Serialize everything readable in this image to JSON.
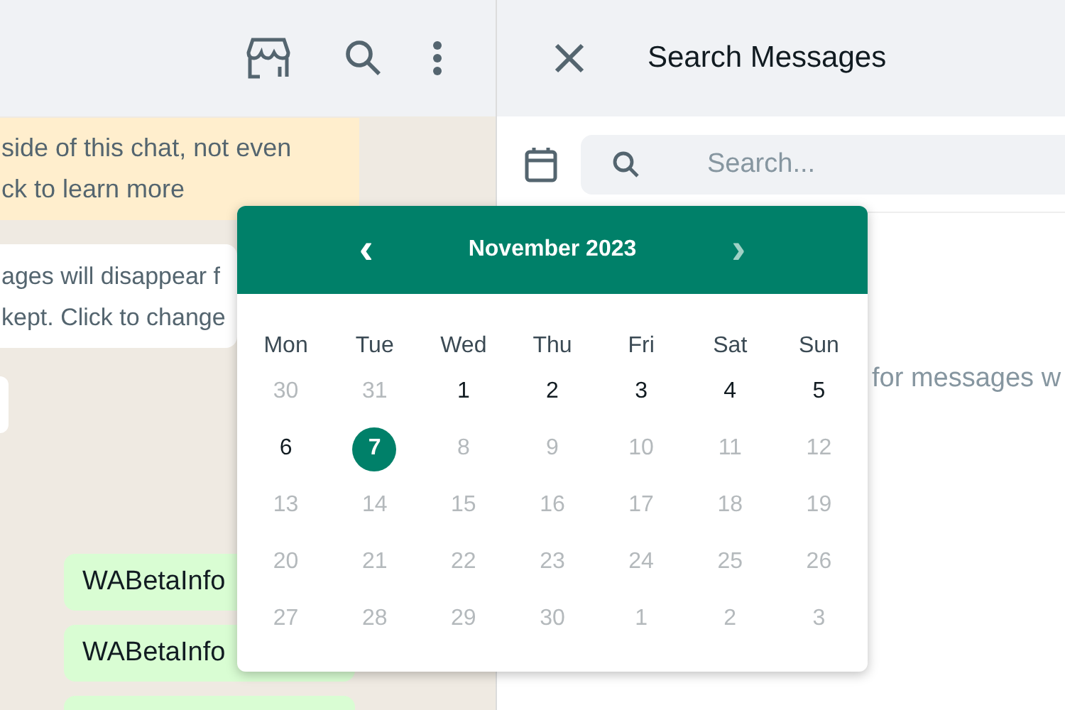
{
  "chat": {
    "banner_lines": [
      "side of this chat, not even",
      "ck to learn more"
    ],
    "system_lines": [
      "ages will disappear f",
      "kept. Click to change"
    ],
    "bubbles": [
      {
        "kind": "text",
        "text": "WABetaInfo"
      },
      {
        "kind": "text",
        "text": "WABetaInfo"
      },
      {
        "kind": "blank"
      }
    ]
  },
  "search_panel": {
    "title": "Search Messages",
    "search": {
      "placeholder": "Search..."
    },
    "hint": "for messages w"
  },
  "calendar": {
    "prev": "‹",
    "month": "November 2023",
    "next": "›",
    "weekdays": [
      "Mon",
      "Tue",
      "Wed",
      "Thu",
      "Fri",
      "Sat",
      "Sun"
    ],
    "days": [
      {
        "label": "30",
        "disabled": true,
        "selected": false
      },
      {
        "label": "31",
        "disabled": true,
        "selected": false
      },
      {
        "label": "1",
        "disabled": false,
        "selected": false
      },
      {
        "label": "2",
        "disabled": false,
        "selected": false
      },
      {
        "label": "3",
        "disabled": false,
        "selected": false
      },
      {
        "label": "4",
        "disabled": false,
        "selected": false
      },
      {
        "label": "5",
        "disabled": false,
        "selected": false
      },
      {
        "label": "6",
        "disabled": false,
        "selected": false
      },
      {
        "label": "7",
        "disabled": false,
        "selected": true
      },
      {
        "label": "8",
        "disabled": true,
        "selected": false
      },
      {
        "label": "9",
        "disabled": true,
        "selected": false
      },
      {
        "label": "10",
        "disabled": true,
        "selected": false
      },
      {
        "label": "11",
        "disabled": true,
        "selected": false
      },
      {
        "label": "12",
        "disabled": true,
        "selected": false
      },
      {
        "label": "13",
        "disabled": true,
        "selected": false
      },
      {
        "label": "14",
        "disabled": true,
        "selected": false
      },
      {
        "label": "15",
        "disabled": true,
        "selected": false
      },
      {
        "label": "16",
        "disabled": true,
        "selected": false
      },
      {
        "label": "17",
        "disabled": true,
        "selected": false
      },
      {
        "label": "18",
        "disabled": true,
        "selected": false
      },
      {
        "label": "19",
        "disabled": true,
        "selected": false
      },
      {
        "label": "20",
        "disabled": true,
        "selected": false
      },
      {
        "label": "21",
        "disabled": true,
        "selected": false
      },
      {
        "label": "22",
        "disabled": true,
        "selected": false
      },
      {
        "label": "23",
        "disabled": true,
        "selected": false
      },
      {
        "label": "24",
        "disabled": true,
        "selected": false
      },
      {
        "label": "25",
        "disabled": true,
        "selected": false
      },
      {
        "label": "26",
        "disabled": true,
        "selected": false
      },
      {
        "label": "27",
        "disabled": true,
        "selected": false
      },
      {
        "label": "28",
        "disabled": true,
        "selected": false
      },
      {
        "label": "29",
        "disabled": true,
        "selected": false
      },
      {
        "label": "30",
        "disabled": true,
        "selected": false
      },
      {
        "label": "1",
        "disabled": true,
        "selected": false
      },
      {
        "label": "2",
        "disabled": true,
        "selected": false
      },
      {
        "label": "3",
        "disabled": true,
        "selected": false
      }
    ]
  }
}
